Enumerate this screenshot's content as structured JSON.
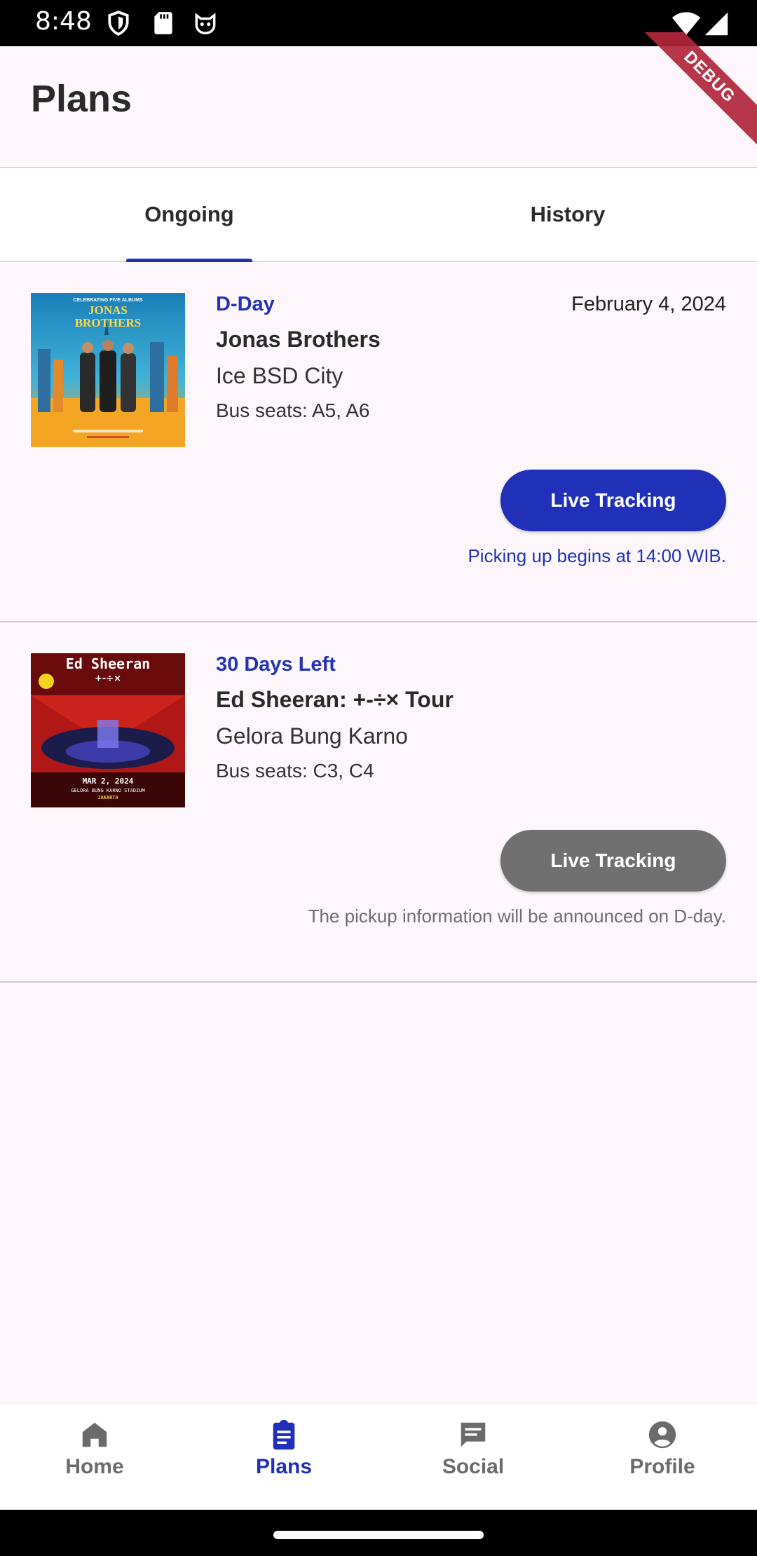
{
  "status_bar": {
    "time": "8:48"
  },
  "app_bar": {
    "title": "Plans",
    "debug_label": "DEBUG"
  },
  "tabs": [
    {
      "label": "Ongoing",
      "active": true
    },
    {
      "label": "History",
      "active": false
    }
  ],
  "plans": [
    {
      "status": "D-Day",
      "date": "February 4, 2024",
      "name": "Jonas Brothers",
      "venue": "Ice BSD City",
      "seats": "Bus seats: A5, A6",
      "button_label": "Live Tracking",
      "button_enabled": true,
      "note": "Picking up begins at 14:00 WIB.",
      "poster_text": {
        "small": "CELEBRATING FIVE ALBUMS",
        "line1": "JONAS",
        "line2": "BROTHERS"
      }
    },
    {
      "status": "30 Days Left",
      "date": "",
      "name": "Ed Sheeran: +-÷× Tour",
      "venue": "Gelora Bung Karno",
      "seats": "Bus seats: C3, C4",
      "button_label": "Live Tracking",
      "button_enabled": false,
      "note": "The pickup information will be announced on D-day.",
      "poster_text": {
        "title": "Ed Sheeran",
        "symbols": "+-÷×",
        "date": "MAR 2, 2024",
        "venue": "GELORA BUNG KARNO STADIUM",
        "city": "JAKARTA"
      }
    }
  ],
  "bottom_nav": [
    {
      "label": "Home",
      "icon": "home-icon",
      "active": false
    },
    {
      "label": "Plans",
      "icon": "clipboard-icon",
      "active": true
    },
    {
      "label": "Social",
      "icon": "chat-icon",
      "active": false
    },
    {
      "label": "Profile",
      "icon": "account-circle-icon",
      "active": false
    }
  ],
  "colors": {
    "accent": "#2030b8",
    "disabled_button": "#707070",
    "note_active": "#2233b5",
    "note_muted": "#6e6e6e"
  }
}
